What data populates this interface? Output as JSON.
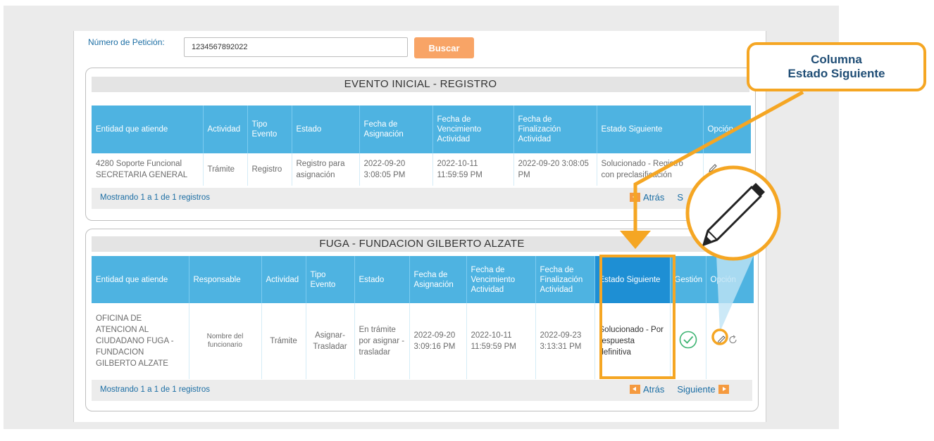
{
  "search": {
    "label": "Número de Petición:",
    "value": "1234567892022",
    "button_label": "Buscar"
  },
  "panel1": {
    "title": "EVENTO INICIAL - REGISTRO",
    "headers": [
      "Entidad que atiende",
      "Actividad",
      "Tipo Evento",
      "Estado",
      "Fecha de Asignación",
      "Fecha de Vencimiento Actividad",
      "Fecha de Finalización Actividad",
      "Estado Siguiente",
      "Opción"
    ],
    "row": {
      "entidad": "4280 Soporte Funcional SECRETARIA GENERAL",
      "actividad": "Trámite",
      "tipo_evento": "Registro",
      "estado": "Registro para asignación",
      "fecha_asignacion": "2022-09-20 3:08:05 PM",
      "fecha_vencimiento": "2022-10-11 11:59:59 PM",
      "fecha_finalizacion": "2022-09-20 3:08:05 PM",
      "estado_siguiente": "Solucionado - Registro con preclasificación"
    },
    "footer_info": "Mostrando 1 a 1 de 1 registros",
    "prev_label": "Atrás",
    "next_label": "S"
  },
  "panel2": {
    "title": "FUGA - FUNDACION GILBERTO ALZATE",
    "headers": [
      "Entidad que atiende",
      "Responsable",
      "Actividad",
      "Tipo Evento",
      "Estado",
      "Fecha de Asignación",
      "Fecha de Vencimiento Actividad",
      "Fecha de Finalización Actividad",
      "Estado Siguiente",
      "Gestión",
      "Opción"
    ],
    "row": {
      "entidad": "OFICINA DE ATENCION AL CIUDADANO FUGA - FUNDACION GILBERTO ALZATE",
      "responsable": "Nombre del funcionario",
      "actividad": "Trámite",
      "tipo_evento": "Asignar-Trasladar",
      "estado": "En trámite por asignar - trasladar",
      "fecha_asignacion": "2022-09-20 3:09:16 PM",
      "fecha_vencimiento": "2022-10-11 11:59:59 PM",
      "fecha_finalizacion": "2022-09-23 3:13:31 PM",
      "estado_siguiente": "Solucionado - Por respuesta definitiva"
    },
    "footer_info": "Mostrando 1 a 1 de 1 registros",
    "prev_label": "Atrás",
    "next_label": "Siguiente"
  },
  "callout": {
    "line1": "Columna",
    "line2": "Estado Siguiente"
  },
  "colors": {
    "header_blue": "#4eb3e1",
    "highlight_blue": "#1e8fd4",
    "accent_orange": "#f5a623",
    "button_orange": "#f8a466",
    "link_blue": "#1c6ea4",
    "check_green": "#3cb371"
  },
  "icons": {
    "gestion": "check-circle-icon",
    "edit": "pencil-icon",
    "refresh": "refresh-icon"
  }
}
